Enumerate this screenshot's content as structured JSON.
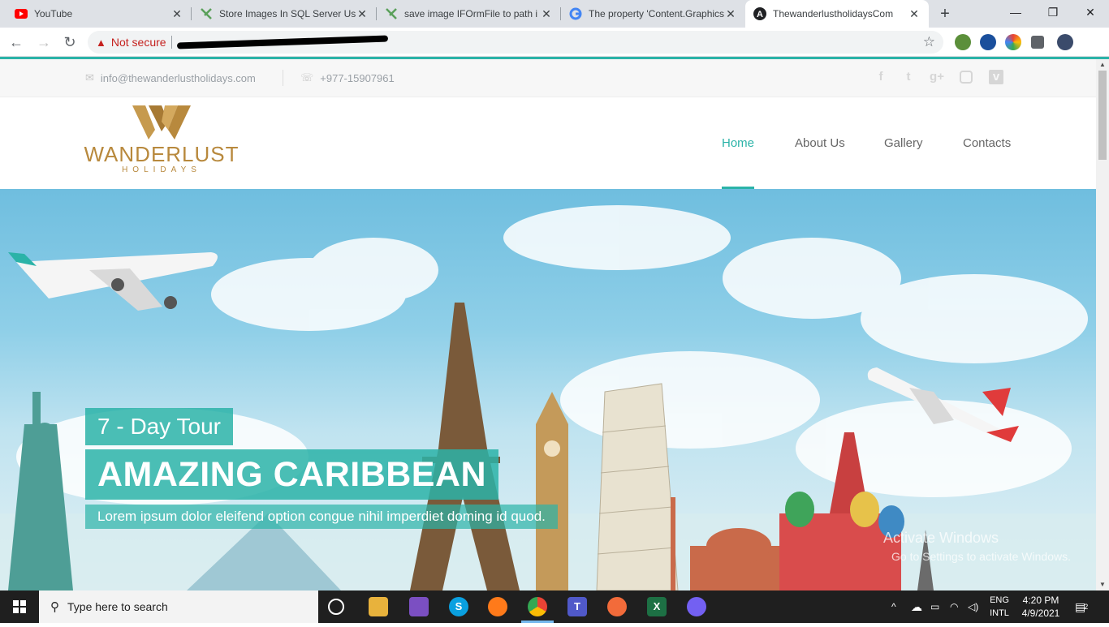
{
  "browser": {
    "tabs": [
      {
        "title": "YouTube",
        "icon": "youtube-icon",
        "active": false
      },
      {
        "title": "Store Images In SQL Server Usi",
        "icon": "stackify-icon",
        "active": false
      },
      {
        "title": "save image IFOrmFile to path i",
        "icon": "stackify-icon",
        "active": false
      },
      {
        "title": "The property 'Content.Graphics",
        "icon": "google-icon",
        "active": false
      },
      {
        "title": "ThewanderlustholidaysCom",
        "icon": "angular-icon",
        "active": true
      }
    ],
    "new_tab": "+",
    "security_label": "Not secure",
    "window_controls": {
      "minimize": "—",
      "restore": "❐",
      "close": "✕"
    }
  },
  "site": {
    "email": "info@thewanderlustholidays.com",
    "phone": "+977-15907961",
    "logo": {
      "name": "WANDERLUST",
      "sub": "HOLIDAYS"
    },
    "nav": [
      {
        "label": "Home",
        "active": true
      },
      {
        "label": "About Us",
        "active": false
      },
      {
        "label": "Gallery",
        "active": false
      },
      {
        "label": "Contacts",
        "active": false
      }
    ],
    "social": [
      "f",
      "t",
      "g+",
      "ig",
      "v"
    ],
    "hero": {
      "tag": "7 - Day Tour",
      "headline": "AMAZING CARIBBEAN",
      "subline": "Lorem ipsum dolor eleifend option congue nihil imperdiet doming id quod."
    }
  },
  "watermark": {
    "line1": "Activate Windows",
    "line2": "Go to Settings to activate Windows."
  },
  "taskbar": {
    "search_placeholder": "Type here to search",
    "language": {
      "line1": "ENG",
      "line2": "INTL"
    },
    "time": "4:20 PM",
    "date": "4/9/2021",
    "notifications": "2"
  },
  "colors": {
    "accent": "#2bb3a8",
    "logo_gold": "#b8893d"
  }
}
